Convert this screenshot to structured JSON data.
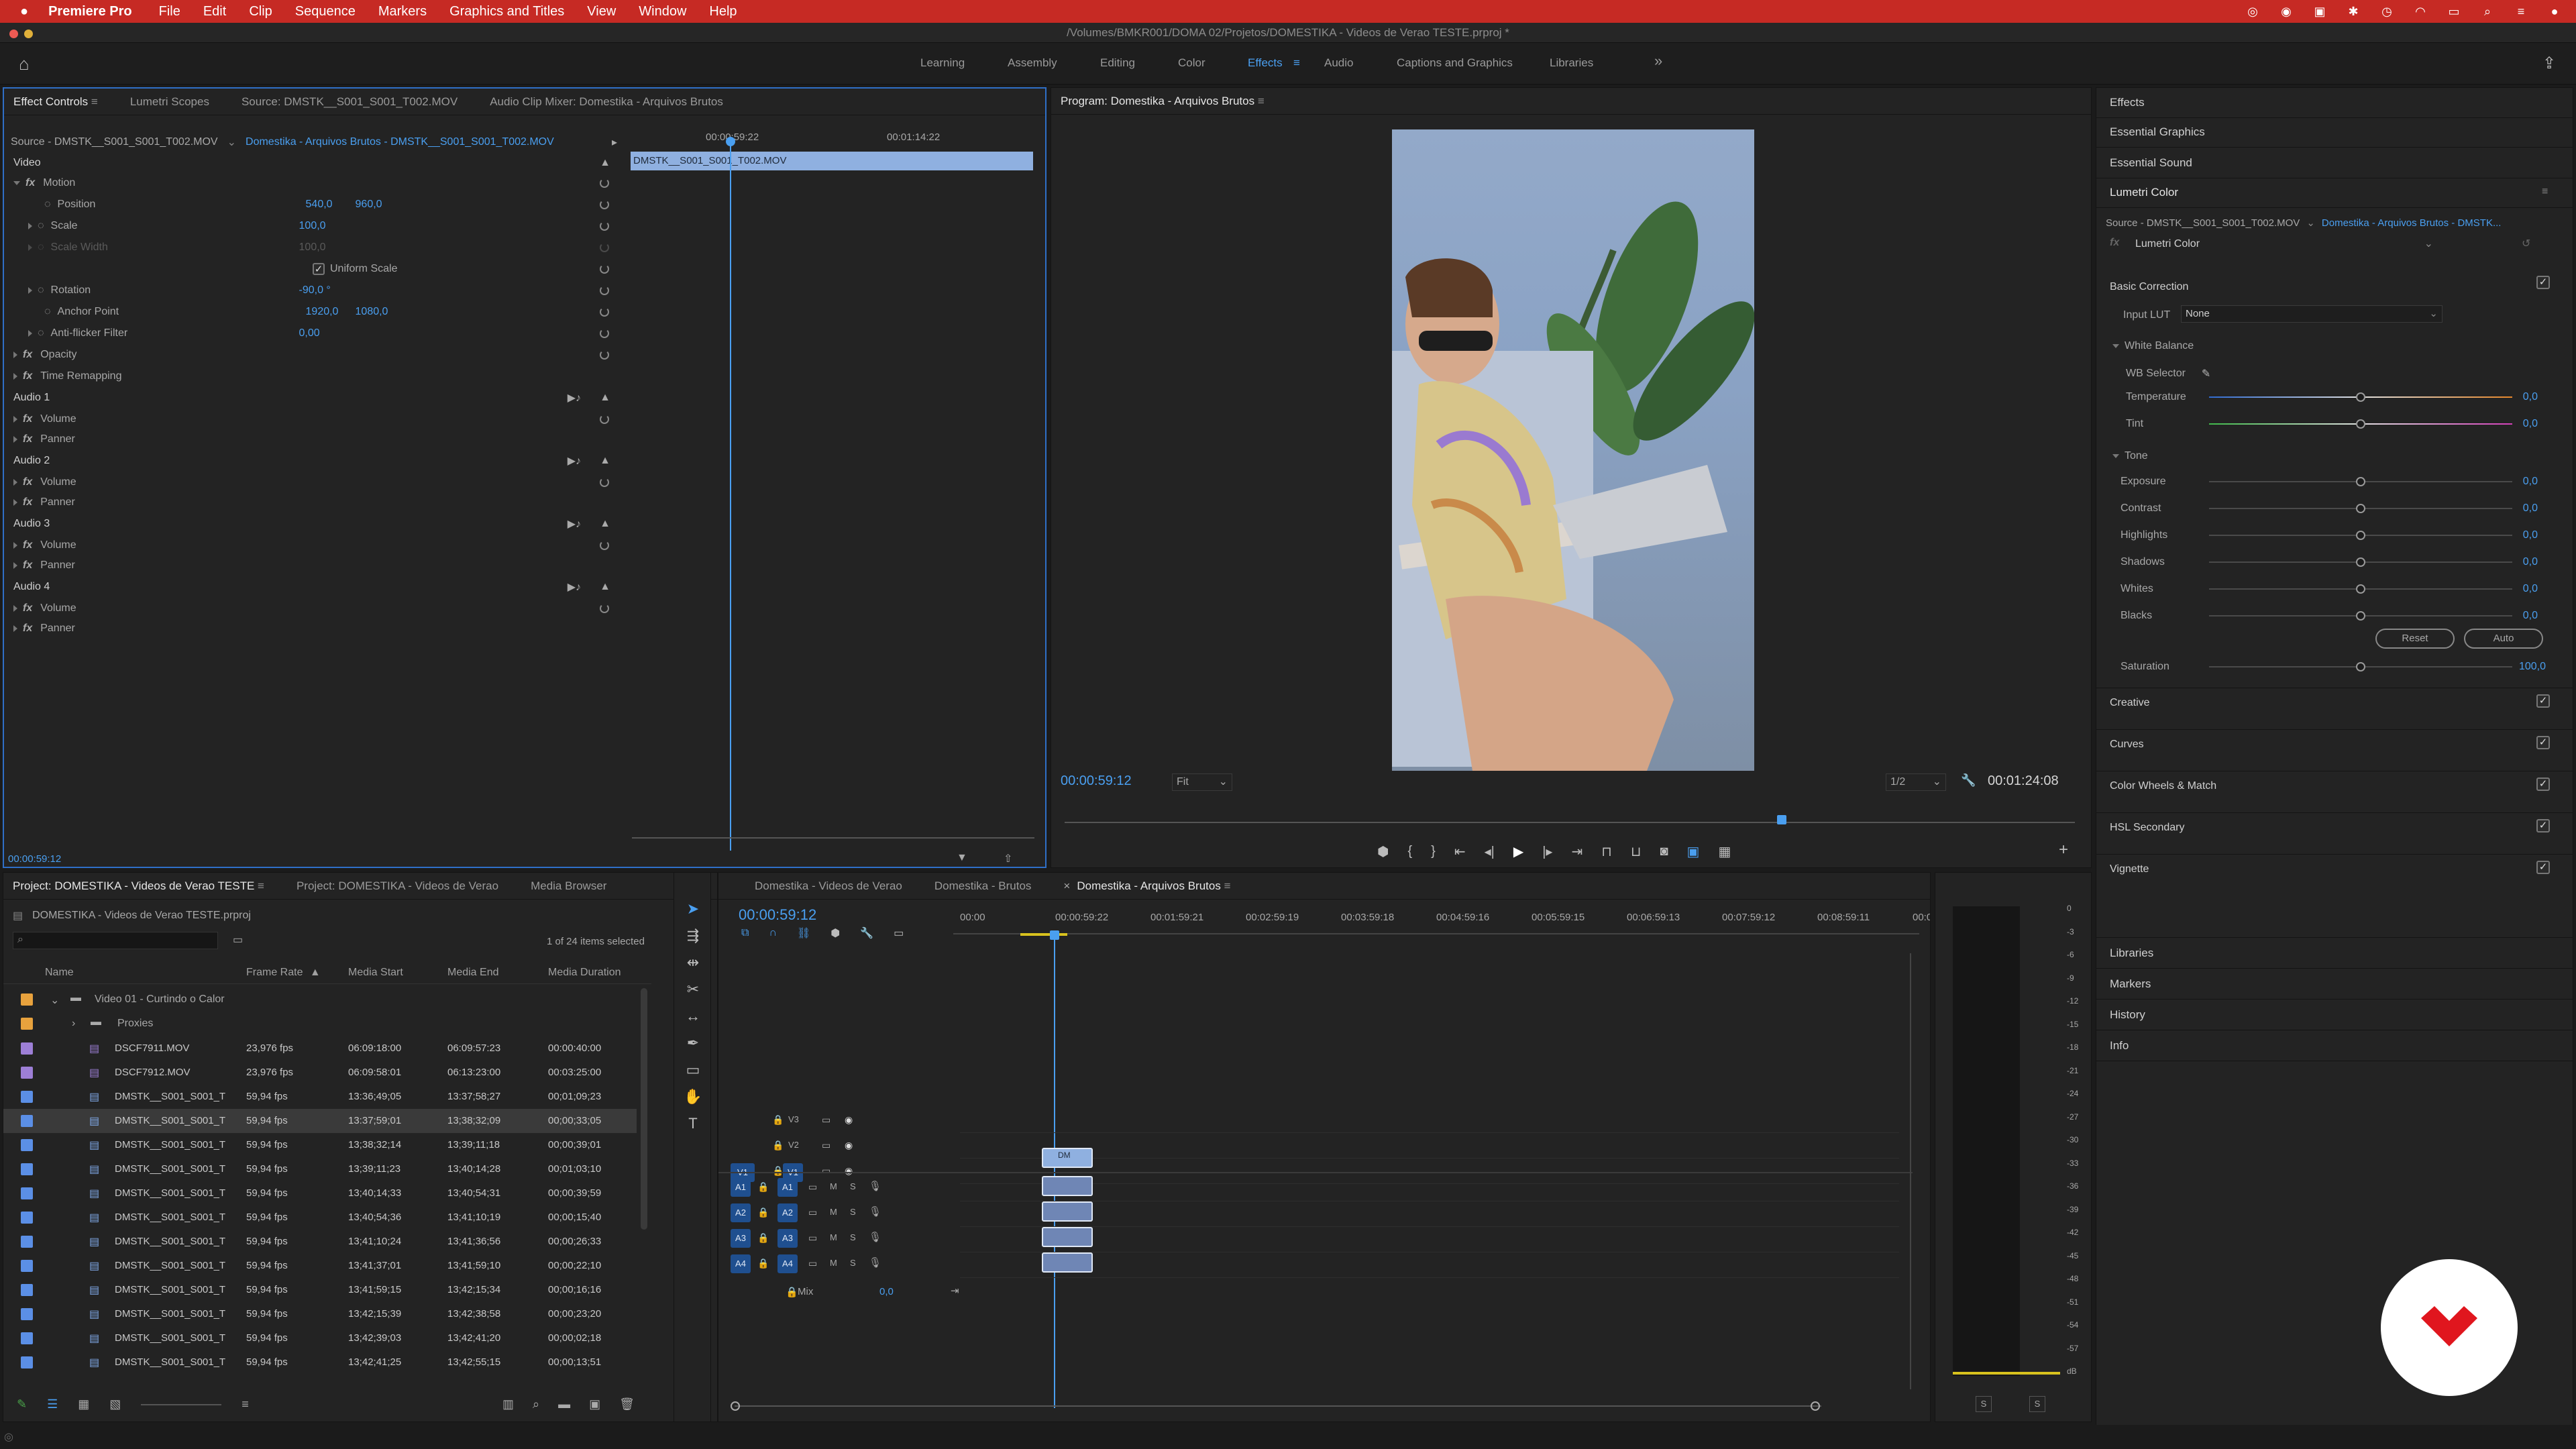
{
  "menubar": {
    "app": "Premiere Pro",
    "items": [
      "File",
      "Edit",
      "Clip",
      "Sequence",
      "Markers",
      "Graphics and Titles",
      "View",
      "Window",
      "Help"
    ]
  },
  "titlebar": {
    "path": "/Volumes/BMKR001/DOMA 02/Projetos/DOMESTIKA - Videos de Verao TESTE.prproj *"
  },
  "workspaces": {
    "items": [
      "Learning",
      "Assembly",
      "Editing",
      "Color",
      "Effects",
      "Audio",
      "Captions and Graphics",
      "Libraries"
    ],
    "active": "Effects",
    "more": "»"
  },
  "effect_controls": {
    "tabs": [
      "Effect Controls",
      "Lumetri Scopes",
      "Source: DMSTK__S001_S001_T002.MOV",
      "Audio Clip Mixer: Domestika - Arquivos Brutos"
    ],
    "source_label": "Source - DMSTK__S001_S001_T002.MOV",
    "sequence_label": "Domestika - Arquivos Brutos - DMSTK__S001_S001_T002.MOV",
    "ruler": [
      "00:00:59:22",
      "00:01:14:22"
    ],
    "clip_name": "DMSTK__S001_S001_T002.MOV",
    "video_header": "Video",
    "motion": "Motion",
    "position": {
      "label": "Position",
      "x": "540,0",
      "y": "960,0"
    },
    "scale": {
      "label": "Scale",
      "v": "100,0"
    },
    "scale_width": {
      "label": "Scale Width",
      "v": "100,0"
    },
    "uniform_scale": "Uniform Scale",
    "rotation": {
      "label": "Rotation",
      "v": "-90,0 °"
    },
    "anchor": {
      "label": "Anchor Point",
      "x": "1920,0",
      "y": "1080,0"
    },
    "antiflicker": {
      "label": "Anti-flicker Filter",
      "v": "0,00"
    },
    "opacity": "Opacity",
    "time_remap": "Time Remapping",
    "audio_sections": [
      {
        "name": "Audio 1",
        "volume": "Volume",
        "panner": "Panner"
      },
      {
        "name": "Audio 2",
        "volume": "Volume",
        "panner": "Panner"
      },
      {
        "name": "Audio 3",
        "volume": "Volume",
        "panner": "Panner"
      },
      {
        "name": "Audio 4",
        "volume": "Volume",
        "panner": "Panner"
      }
    ],
    "timecode": "00:00:59:12"
  },
  "program": {
    "title": "Program: Domestika - Arquivos Brutos",
    "timecode": "00:00:59:12",
    "fit": "Fit",
    "res": "1/2",
    "duration": "00:01:24:08",
    "playhead_fraction": 0.71
  },
  "lumetri": {
    "effects_panels": [
      "Effects",
      "Essential Graphics",
      "Essential Sound"
    ],
    "title": "Lumetri Color",
    "source_label": "Source - DMSTK__S001_S001_T002.MOV",
    "seq_label": "Domestika - Arquivos Brutos - DMSTK...",
    "effect_select": "Lumetri Color",
    "basic": "Basic Correction",
    "input_lut_label": "Input LUT",
    "input_lut": "None",
    "wb": "White Balance",
    "wb_selector": "WB Selector",
    "tone": "Tone",
    "sliders": [
      {
        "label": "Temperature",
        "value": "0,0",
        "pos": 0.5
      },
      {
        "label": "Tint",
        "value": "0,0",
        "pos": 0.5
      },
      {
        "label": "Exposure",
        "value": "0,0",
        "pos": 0.5
      },
      {
        "label": "Contrast",
        "value": "0,0",
        "pos": 0.5
      },
      {
        "label": "Highlights",
        "value": "0,0",
        "pos": 0.5
      },
      {
        "label": "Shadows",
        "value": "0,0",
        "pos": 0.5
      },
      {
        "label": "Whites",
        "value": "0,0",
        "pos": 0.5
      },
      {
        "label": "Blacks",
        "value": "0,0",
        "pos": 0.5
      },
      {
        "label": "Saturation",
        "value": "100,0",
        "pos": 0.5
      }
    ],
    "reset": "Reset",
    "auto": "Auto",
    "sections": [
      "Creative",
      "Curves",
      "Color Wheels & Match",
      "HSL Secondary",
      "Vignette"
    ],
    "bottom_panels": [
      "Libraries",
      "Markers",
      "History",
      "Info"
    ]
  },
  "project": {
    "tabs": [
      "Project: DOMESTIKA - Videos de Verao TESTE",
      "Project: DOMESTIKA - Videos de Verao",
      "Media Browser"
    ],
    "file": "DOMESTIKA - Videos de Verao TESTE.prproj",
    "selection": "1 of 24 items selected",
    "columns": [
      "Name",
      "Frame Rate",
      "Media Start",
      "Media End",
      "Media Duration"
    ],
    "folder": "Video 01 - Curtindo o Calor",
    "subfolder": "Proxies",
    "rows": [
      {
        "color": "#9d7fd6",
        "name": "DSCF7911.MOV",
        "fps": "23,976 fps",
        "start": "06:09:18:00",
        "end": "06:09:57:23",
        "dur": "00:00:40:00"
      },
      {
        "color": "#9d7fd6",
        "name": "DSCF7912.MOV",
        "fps": "23,976 fps",
        "start": "06:09:58:01",
        "end": "06:13:23:00",
        "dur": "00:03:25:00"
      },
      {
        "color": "#5b8fe6",
        "name": "DMSTK__S001_S001_T",
        "fps": "59,94 fps",
        "start": "13:36;49;05",
        "end": "13:37;58;27",
        "dur": "00;01;09;23"
      },
      {
        "color": "#5b8fe6",
        "name": "DMSTK__S001_S001_T",
        "fps": "59,94 fps",
        "start": "13:37;59;01",
        "end": "13;38;32;09",
        "dur": "00;00;33;05"
      },
      {
        "color": "#5b8fe6",
        "name": "DMSTK__S001_S001_T",
        "fps": "59,94 fps",
        "start": "13;38;32;14",
        "end": "13;39;11;18",
        "dur": "00;00;39;01"
      },
      {
        "color": "#5b8fe6",
        "name": "DMSTK__S001_S001_T",
        "fps": "59,94 fps",
        "start": "13;39;11;23",
        "end": "13;40;14;28",
        "dur": "00;01;03;10"
      },
      {
        "color": "#5b8fe6",
        "name": "DMSTK__S001_S001_T",
        "fps": "59,94 fps",
        "start": "13;40;14;33",
        "end": "13;40;54;31",
        "dur": "00;00;39;59"
      },
      {
        "color": "#5b8fe6",
        "name": "DMSTK__S001_S001_T",
        "fps": "59,94 fps",
        "start": "13;40;54;36",
        "end": "13;41;10;19",
        "dur": "00;00;15;40"
      },
      {
        "color": "#5b8fe6",
        "name": "DMSTK__S001_S001_T",
        "fps": "59,94 fps",
        "start": "13;41;10;24",
        "end": "13;41;36;56",
        "dur": "00;00;26;33"
      },
      {
        "color": "#5b8fe6",
        "name": "DMSTK__S001_S001_T",
        "fps": "59,94 fps",
        "start": "13;41;37;01",
        "end": "13;41;59;10",
        "dur": "00;00;22;10"
      },
      {
        "color": "#5b8fe6",
        "name": "DMSTK__S001_S001_T",
        "fps": "59,94 fps",
        "start": "13;41;59;15",
        "end": "13;42;15;34",
        "dur": "00;00;16;16"
      },
      {
        "color": "#5b8fe6",
        "name": "DMSTK__S001_S001_T",
        "fps": "59,94 fps",
        "start": "13;42;15;39",
        "end": "13;42;38;58",
        "dur": "00;00;23;20"
      },
      {
        "color": "#5b8fe6",
        "name": "DMSTK__S001_S001_T",
        "fps": "59,94 fps",
        "start": "13;42;39;03",
        "end": "13;42;41;20",
        "dur": "00;00;02;18"
      },
      {
        "color": "#5b8fe6",
        "name": "DMSTK__S001_S001_T",
        "fps": "59,94 fps",
        "start": "13;42;41;25",
        "end": "13;42;55;15",
        "dur": "00;00;13;51"
      }
    ]
  },
  "timeline": {
    "tabs": [
      "Domestika - Videos de Verao",
      "Domestika - Brutos",
      "Domestika - Arquivos Brutos"
    ],
    "timecode": "00:00:59:12",
    "ruler": [
      "00:00",
      "00:00:59:22",
      "00:01:59:21",
      "00:02:59:19",
      "00:03:59:18",
      "00:04:59:16",
      "00:05:59:15",
      "00:06:59:13",
      "00:07:59:12",
      "00:08:59:11",
      "00:0"
    ],
    "video_tracks": [
      "V3",
      "V2",
      "V1"
    ],
    "audio_tracks": [
      "A1",
      "A2",
      "A3",
      "A4"
    ],
    "mix_label": "Mix",
    "mix_value": "0,0",
    "clip_label": "DM"
  },
  "meter": {
    "scale": [
      "0",
      "-3",
      "-6",
      "-9",
      "-12",
      "-15",
      "-18",
      "-21",
      "-24",
      "-27",
      "-30",
      "-33",
      "-36",
      "-39",
      "-42",
      "-45",
      "-48",
      "-51",
      "-54",
      "-57",
      "dB"
    ],
    "solo": [
      "S",
      "S"
    ]
  }
}
